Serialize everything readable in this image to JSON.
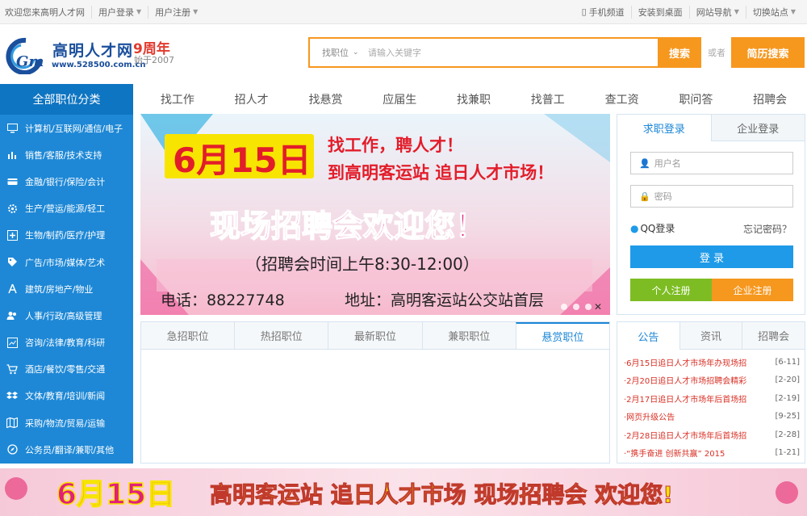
{
  "topbar": {
    "welcome": "欢迎您来高明人才网",
    "user_login": "用户登录",
    "user_register": "用户注册",
    "mobile": "手机频道",
    "install_desktop": "安装到桌面",
    "site_nav": "网站导航",
    "switch_site": "切换站点"
  },
  "logo": {
    "name": "高明人才网",
    "url": "www.528500.com.cn",
    "anniversary": "9周年",
    "since": "始于2007",
    "mark": "Gm"
  },
  "search": {
    "select_label": "找职位",
    "placeholder": "请输入关键字",
    "button": "搜索",
    "or": "或者",
    "resume_button": "简历搜索"
  },
  "sidebar": {
    "title": "全部职位分类",
    "items": [
      {
        "label": "计算机/互联网/通信/电子",
        "icon": "monitor-icon"
      },
      {
        "label": "销售/客服/技术支持",
        "icon": "bar-chart-icon"
      },
      {
        "label": "金融/银行/保险/会计",
        "icon": "card-icon"
      },
      {
        "label": "生产/营运/能源/轻工",
        "icon": "gear-icon"
      },
      {
        "label": "生物/制药/医疗/护理",
        "icon": "plus-box-icon"
      },
      {
        "label": "广告/市场/媒体/艺术",
        "icon": "tag-icon"
      },
      {
        "label": "建筑/房地产/物业",
        "icon": "compass-icon"
      },
      {
        "label": "人事/行政/高级管理",
        "icon": "users-icon"
      },
      {
        "label": "咨询/法律/教育/科研",
        "icon": "chart-box-icon"
      },
      {
        "label": "酒店/餐饮/零售/交通",
        "icon": "cart-icon"
      },
      {
        "label": "文体/教育/培训/新闻",
        "icon": "dropbox-icon"
      },
      {
        "label": "采购/物流/贸易/运输",
        "icon": "map-icon"
      },
      {
        "label": "公务员/翻译/兼职/其他",
        "icon": "compass-circle-icon"
      }
    ]
  },
  "nav": {
    "items": [
      "找工作",
      "招人才",
      "找悬赏",
      "应届生",
      "找兼职",
      "找普工",
      "查工资",
      "职问答",
      "招聘会"
    ]
  },
  "banner": {
    "date": "6月15日",
    "line1": "找工作，聘人才！",
    "line2": "到高明客运站 追日人才市场！",
    "headline": "现场招聘会欢迎您！",
    "time": "（招聘会时间上午8:30-12:00）",
    "phone": "电话：88227748",
    "address": "地址：高明客运站公交站首层",
    "colors": {
      "date_text": "#f7e400",
      "date_bg": "#f7e400",
      "red_text": "#e21d2a",
      "pink_text": "#e2207a"
    }
  },
  "login": {
    "tab_jobseeker": "求职登录",
    "tab_company": "企业登录",
    "username_placeholder": "用户名",
    "password_placeholder": "密码",
    "qq_login": "QQ登录",
    "forgot": "忘记密码？",
    "login_button": "登 录",
    "personal_register": "个人注册",
    "company_register": "企业注册",
    "colors": {
      "login": "#1e9ae8",
      "personal": "#7dbd23",
      "company": "#f6971e"
    }
  },
  "jobs": {
    "tabs": [
      "急招职位",
      "热招职位",
      "最新职位",
      "兼职职位",
      "悬赏职位"
    ],
    "active_tab": "悬赏职位"
  },
  "news": {
    "tabs": [
      "公告",
      "资讯",
      "招聘会"
    ],
    "items": [
      {
        "title": "·6月15日追日人才市场年办现场招",
        "date": "[6-11]"
      },
      {
        "title": "·2月20日追日人才市场招聘会精彩",
        "date": "[2-20]"
      },
      {
        "title": "·2月17日追日人才市场年后首场招",
        "date": "[2-19]"
      },
      {
        "title": "·网页升级公告",
        "date": "[9-25]"
      },
      {
        "title": "·2月28日追日人才市场年后首场招",
        "date": "[2-28]"
      },
      {
        "title": "·“携手奋进 创新共赢” 2015",
        "date": "[1-21]"
      }
    ]
  },
  "bottom_banner": {
    "date": "6月15日",
    "text": "高明客运站 追日人才市场 现场招聘会 欢迎您!"
  },
  "colors": {
    "primary_blue": "#1e88d6",
    "orange": "#f6971e",
    "news_red": "#d93025"
  }
}
